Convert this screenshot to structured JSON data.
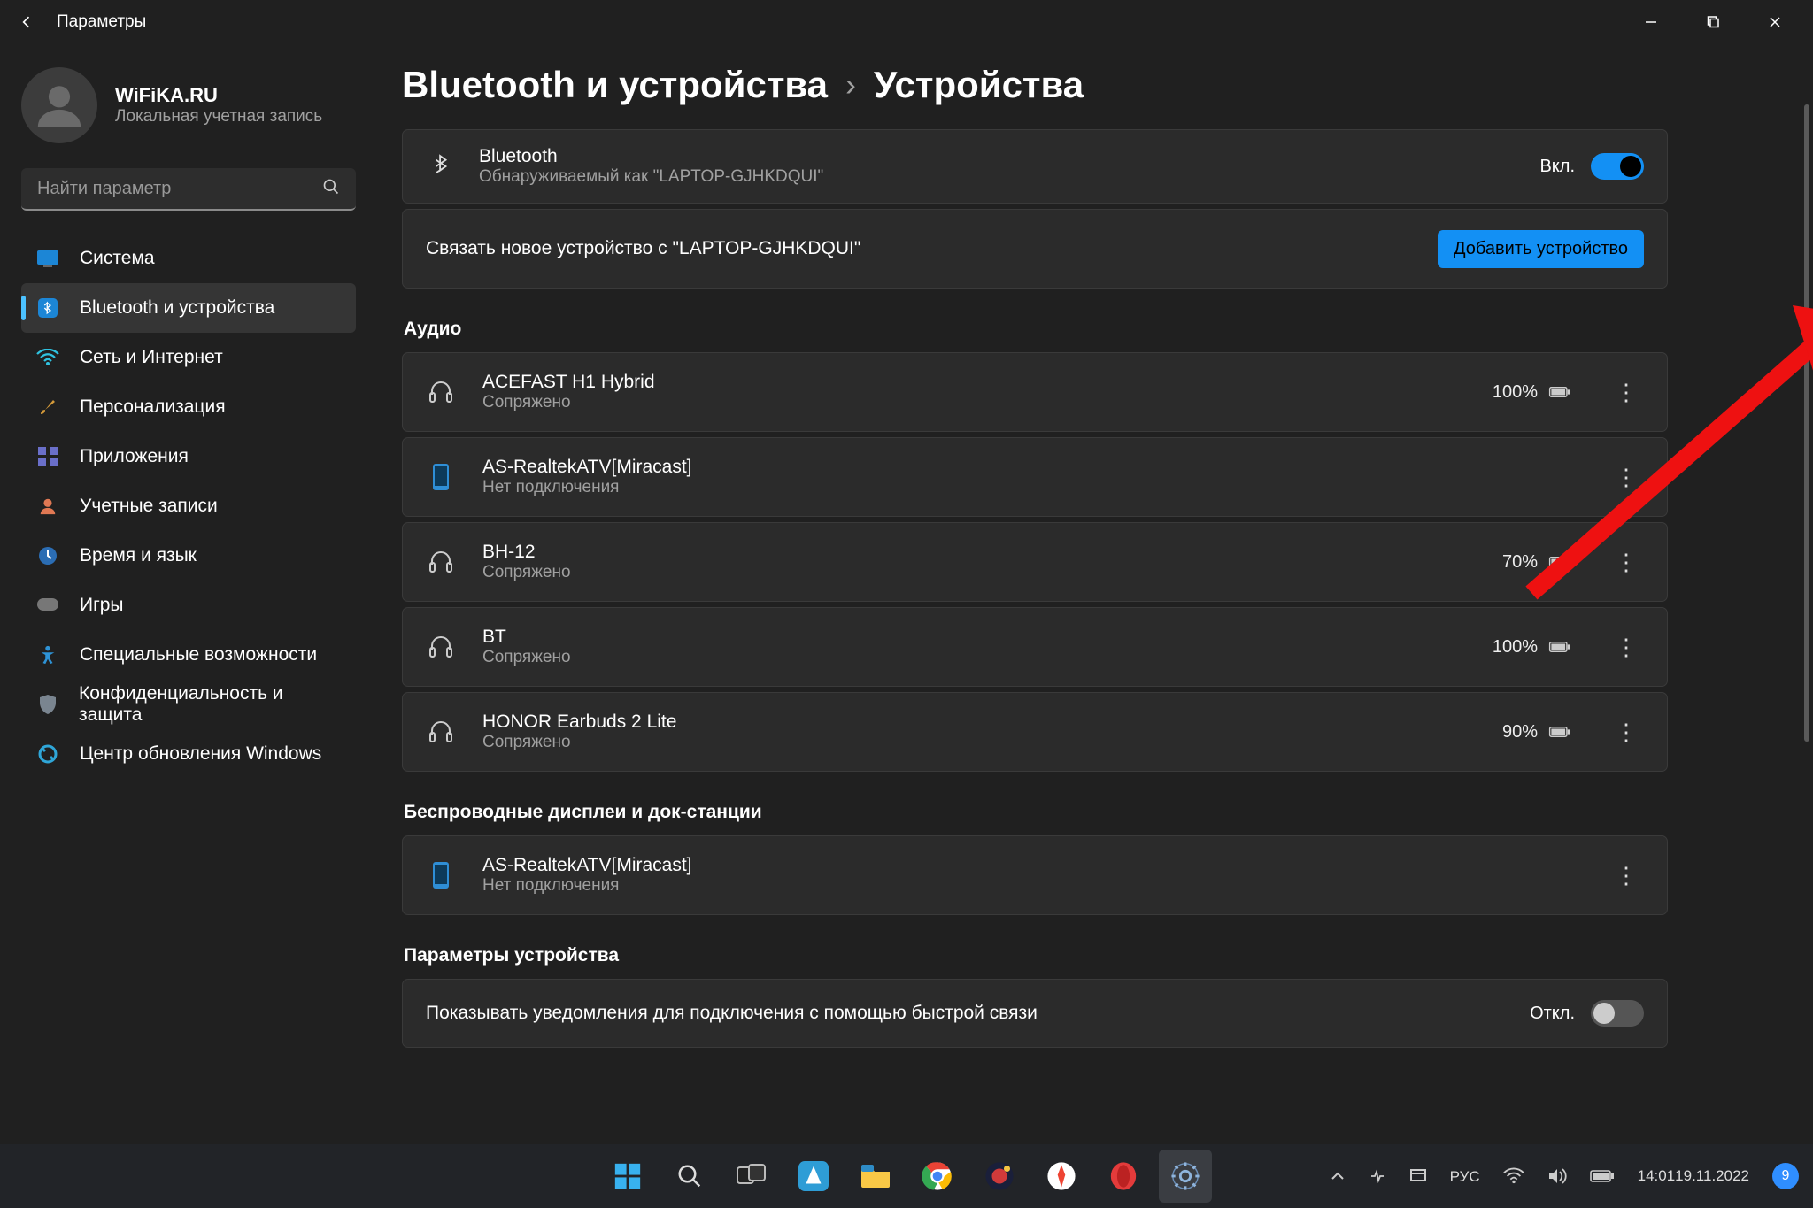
{
  "titlebar": {
    "title": "Параметры"
  },
  "profile": {
    "name": "WiFiKA.RU",
    "sub": "Локальная учетная запись"
  },
  "search": {
    "placeholder": "Найти параметр"
  },
  "sidebar": {
    "items": [
      {
        "label": "Система",
        "icon": "system"
      },
      {
        "label": "Bluetooth и устройства",
        "icon": "bluetooth",
        "active": true
      },
      {
        "label": "Сеть и Интернет",
        "icon": "wifi"
      },
      {
        "label": "Персонализация",
        "icon": "brush"
      },
      {
        "label": "Приложения",
        "icon": "apps"
      },
      {
        "label": "Учетные записи",
        "icon": "person"
      },
      {
        "label": "Время и язык",
        "icon": "globe-time"
      },
      {
        "label": "Игры",
        "icon": "gamepad"
      },
      {
        "label": "Специальные возможности",
        "icon": "accessibility"
      },
      {
        "label": "Конфиденциальность и защита",
        "icon": "shield"
      },
      {
        "label": "Центр обновления Windows",
        "icon": "update"
      }
    ]
  },
  "breadcrumb": {
    "parent": "Bluetooth и устройства",
    "current": "Устройства"
  },
  "bluetooth_card": {
    "title": "Bluetooth",
    "subtitle": "Обнаруживаемый как \"LAPTOP-GJHKDQUI\"",
    "toggle_label": "Вкл."
  },
  "pair_card": {
    "text": "Связать новое устройство с \"LAPTOP-GJHKDQUI\"",
    "button": "Добавить устройство"
  },
  "sections": {
    "audio": "Аудио",
    "wireless": "Беспроводные дисплеи и док-станции",
    "device_params": "Параметры устройства"
  },
  "audio_devices": [
    {
      "name": "ACEFAST H1 Hybrid",
      "status": "Сопряжено",
      "battery": "100%",
      "icon": "headphones"
    },
    {
      "name": "AS-RealtekATV[Miracast]",
      "status": "Нет подключения",
      "battery": "",
      "icon": "phone"
    },
    {
      "name": "BH-12",
      "status": "Сопряжено",
      "battery": "70%",
      "icon": "headphones"
    },
    {
      "name": "BT",
      "status": "Сопряжено",
      "battery": "100%",
      "icon": "headphones"
    },
    {
      "name": "HONOR Earbuds 2 Lite",
      "status": "Сопряжено",
      "battery": "90%",
      "icon": "headphones"
    }
  ],
  "wireless_devices": [
    {
      "name": "AS-RealtekATV[Miracast]",
      "status": "Нет подключения",
      "icon": "phone"
    }
  ],
  "device_params_row": {
    "title": "Показывать уведомления для подключения с помощью быстрой связи",
    "toggle_label": "Откл."
  },
  "tray": {
    "lang": "РУС",
    "time": "14:01",
    "date": "19.11.2022",
    "notif_count": "9"
  }
}
